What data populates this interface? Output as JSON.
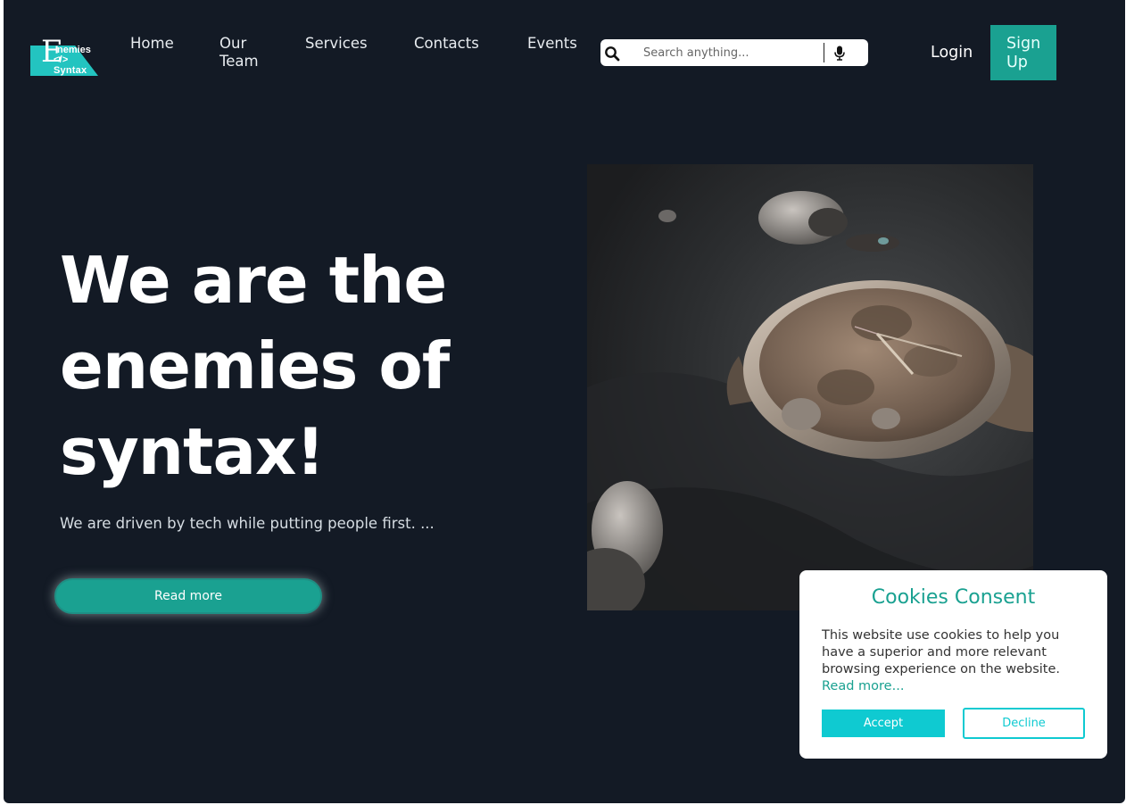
{
  "brand": {
    "logo_initial": "E",
    "logo_word1": "nemies",
    "logo_word2": "</> Syntax",
    "accent_color": "#1aa191",
    "cyan_color": "#0fcad1",
    "background_color": "#131a25"
  },
  "nav": {
    "items": [
      {
        "label": "Home"
      },
      {
        "label": "Our Team"
      },
      {
        "label": "Services"
      },
      {
        "label": "Contacts"
      },
      {
        "label": "Events"
      }
    ]
  },
  "search": {
    "placeholder": "Search anything...",
    "value": "",
    "search_icon": "search-icon",
    "mic_icon": "microphone-icon"
  },
  "auth": {
    "login_label": "Login",
    "signup_label": "Sign Up"
  },
  "hero": {
    "title": "We are the enemies of syntax!",
    "subtitle": "We are driven by tech while putting people first. ...",
    "cta_label": "Read more",
    "image": "wristwatch-photo"
  },
  "cookie_consent": {
    "title": "Cookies Consent",
    "message": "This website use cookies to help you have a superior and more relevant browsing experience on the website.",
    "link_label": "Read more...",
    "accept_label": "Accept",
    "decline_label": "Decline"
  }
}
